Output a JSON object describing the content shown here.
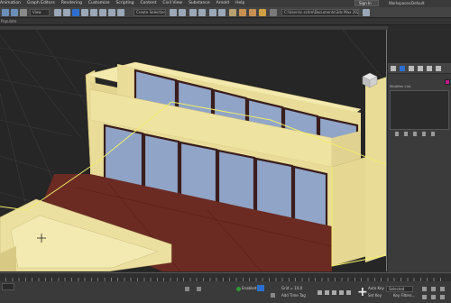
{
  "menu": {
    "items": [
      "Animation",
      "Graph Editors",
      "Rendering",
      "Customize",
      "Scripting",
      "Content",
      "Civil View",
      "Substance",
      "Arnold",
      "Help"
    ]
  },
  "account": {
    "signin_label": "Sign In"
  },
  "workspace": {
    "label": "Workspaces:",
    "value": "Default"
  },
  "toolbar": {
    "view_dropdown": "View",
    "selection_set": "Create Selection Se",
    "project_path": "C:\\Users\\c.schm\\Documents\\3ds Max 2025"
  },
  "ribbon": {
    "tab": "Populate"
  },
  "command_panel": {
    "modifier_list_label": "Modifier List",
    "object_color": "#c21a8a"
  },
  "status": {
    "grid_label": "Grid = 10,0",
    "add_time_tag": "Add Time Tag",
    "enabled_label": "Enabled:",
    "auto_key": "Auto Key",
    "set_key": "Set Key",
    "selected_dropdown": "Selected",
    "key_filters": "Key Filters..."
  },
  "colors": {
    "building_wall": "#f2e6a6",
    "window_glass": "#8fa4c6",
    "window_frame": "#3a1d1d",
    "floor_deck": "#6b2a22",
    "selection": "#f0ec6a",
    "accent_blue": "#1b6fd6"
  }
}
